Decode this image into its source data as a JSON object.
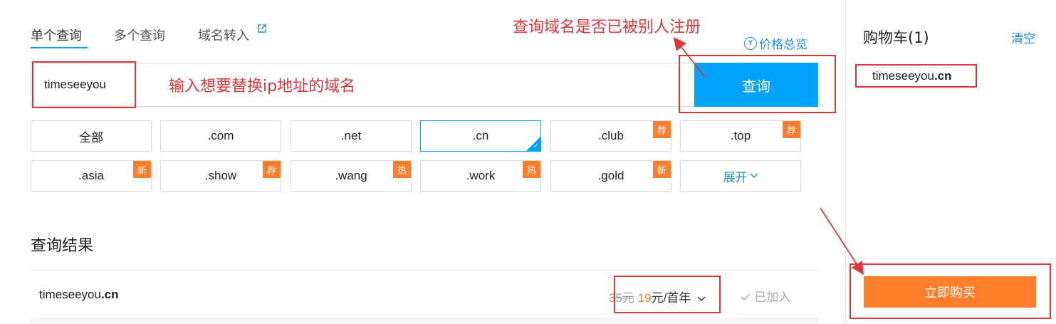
{
  "tabs": [
    {
      "label": "单个查询"
    },
    {
      "label": "多个查询"
    },
    {
      "label": "域名转入"
    }
  ],
  "price_overview": {
    "label": "价格总览",
    "icon": "coin-icon"
  },
  "search": {
    "value": "timeseeyou",
    "button": "查询"
  },
  "suffixes": [
    {
      "label": "全部",
      "badge": ""
    },
    {
      "label": ".com",
      "badge": ""
    },
    {
      "label": ".net",
      "badge": ""
    },
    {
      "label": ".cn",
      "badge": "",
      "selected": true
    },
    {
      "label": ".club",
      "badge": "荐"
    },
    {
      "label": ".top",
      "badge": "荐"
    },
    {
      "label": ".asia",
      "badge": "新"
    },
    {
      "label": ".show",
      "badge": "荐"
    },
    {
      "label": ".wang",
      "badge": "热"
    },
    {
      "label": ".work",
      "badge": "热"
    },
    {
      "label": ".gold",
      "badge": "新"
    },
    {
      "label": "展开",
      "badge": ""
    }
  ],
  "result": {
    "title": "查询结果",
    "domain_name": "timeseeyou",
    "domain_suffix": ".cn",
    "old_price": "35元",
    "new_price": "19",
    "price_unit": "元/首年",
    "status": "已加入"
  },
  "cart": {
    "title": "购物车(1)",
    "clear": "清空",
    "item_name": "timeseeyou",
    "item_suffix": ".cn",
    "buy": "立即购买"
  },
  "annotations": {
    "query_note": "查询域名是否已被别人注册",
    "input_note": "输入想要替换ip地址的域名",
    "color": "#e0363a"
  },
  "colors": {
    "accent": "#00a4ff",
    "badge": "#ff7d2b",
    "link": "#1e90d8"
  }
}
